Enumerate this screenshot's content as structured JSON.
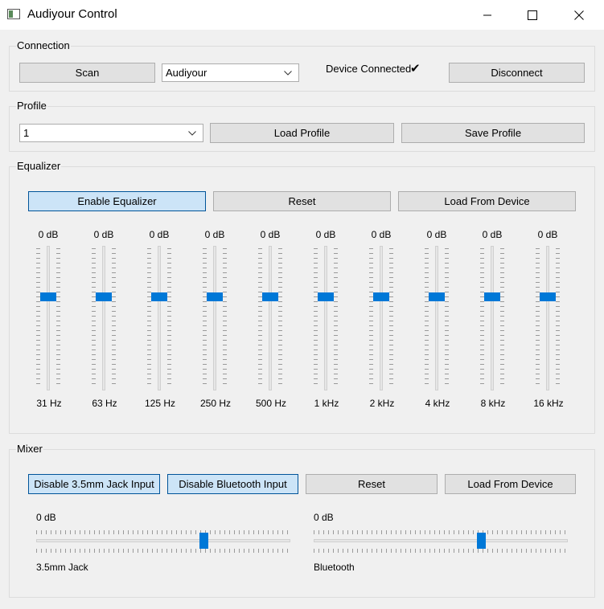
{
  "window": {
    "title": "Audiyour Control",
    "controls": [
      "minimize-icon",
      "maximize-icon",
      "close-icon"
    ]
  },
  "connection": {
    "group_label": "Connection",
    "scan_label": "Scan",
    "device_combo": {
      "value": "Audiyour"
    },
    "status_text": "Device Connected",
    "status_icon": "check-icon",
    "status_mark": "✔",
    "disconnect_label": "Disconnect"
  },
  "profile": {
    "group_label": "Profile",
    "profile_combo": {
      "value": "1"
    },
    "load_label": "Load Profile",
    "save_label": "Save Profile"
  },
  "equalizer": {
    "group_label": "Equalizer",
    "enable_label": "Enable Equalizer",
    "enable_active": true,
    "reset_label": "Reset",
    "load_label": "Load From Device",
    "level_range_fraction": 0.35,
    "bands": [
      {
        "freq": "31 Hz",
        "gain": "0 dB"
      },
      {
        "freq": "63 Hz",
        "gain": "0 dB"
      },
      {
        "freq": "125 Hz",
        "gain": "0 dB"
      },
      {
        "freq": "250 Hz",
        "gain": "0 dB"
      },
      {
        "freq": "500 Hz",
        "gain": "0 dB"
      },
      {
        "freq": "1 kHz",
        "gain": "0 dB"
      },
      {
        "freq": "2 kHz",
        "gain": "0 dB"
      },
      {
        "freq": "4 kHz",
        "gain": "0 dB"
      },
      {
        "freq": "8 kHz",
        "gain": "0 dB"
      },
      {
        "freq": "16 kHz",
        "gain": "0 dB"
      }
    ]
  },
  "mixer": {
    "group_label": "Mixer",
    "disable_jack_label": "Disable 3.5mm Jack Input",
    "disable_bt_label": "Disable Bluetooth Input",
    "reset_label": "Reset",
    "load_label": "Load From Device",
    "channels": [
      {
        "name": "3.5mm Jack",
        "gain": "0 dB",
        "level_fraction": 0.66
      },
      {
        "name": "Bluetooth",
        "gain": "0 dB",
        "level_fraction": 0.66
      }
    ]
  },
  "colors": {
    "accent": "#0078d7",
    "active_button_bg": "#cce4f7",
    "active_button_border": "#005499",
    "button_bg": "#e1e1e1"
  }
}
